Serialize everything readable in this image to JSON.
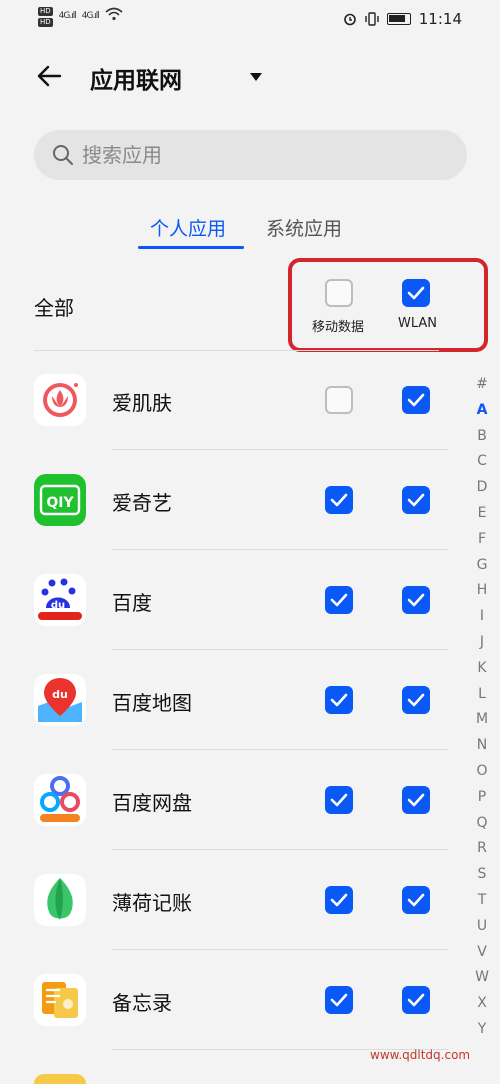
{
  "status": {
    "signal": "4G",
    "time": "11:14"
  },
  "header": {
    "title": "应用联网"
  },
  "search": {
    "placeholder": "搜索应用"
  },
  "tabs": {
    "personal": "个人应用",
    "system": "系统应用",
    "active": "personal"
  },
  "all_row": {
    "label": "全部",
    "mobile_data_label": "移动数据",
    "wlan_label": "WLAN",
    "mobile_data_checked": false,
    "wlan_checked": true
  },
  "apps": [
    {
      "name": "爱肌肤",
      "mobile": false,
      "wlan": true
    },
    {
      "name": "爱奇艺",
      "mobile": true,
      "wlan": true
    },
    {
      "name": "百度",
      "mobile": true,
      "wlan": true
    },
    {
      "name": "百度地图",
      "mobile": true,
      "wlan": true
    },
    {
      "name": "百度网盘",
      "mobile": true,
      "wlan": true
    },
    {
      "name": "薄荷记账",
      "mobile": true,
      "wlan": true
    },
    {
      "name": "备忘录",
      "mobile": true,
      "wlan": true
    }
  ],
  "alphabet": [
    "#",
    "A",
    "B",
    "C",
    "D",
    "E",
    "F",
    "G",
    "H",
    "I",
    "J",
    "K",
    "L",
    "M",
    "N",
    "O",
    "P",
    "Q",
    "R",
    "S",
    "T",
    "U",
    "V",
    "W",
    "X",
    "Y"
  ],
  "alphabet_active": "A",
  "watermark": "www.qdltdq.com",
  "colors": {
    "accent": "#0a59f7",
    "highlight_border": "#d4252c",
    "background": "#f3f3f3"
  }
}
